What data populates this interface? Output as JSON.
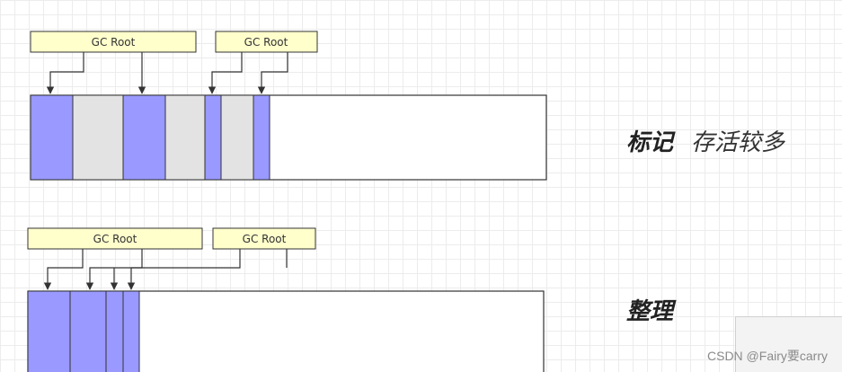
{
  "diagram": {
    "colors": {
      "live": "#9999ff",
      "garbage": "#e3e3e3",
      "free": "#ffffff",
      "root_fill": "#ffffcc",
      "line": "#333333"
    },
    "mark_phase": {
      "roots": [
        "GC Root",
        "GC Root"
      ],
      "title": "标记",
      "subtitle": "存活较多"
    },
    "compact_phase": {
      "roots": [
        "GC Root",
        "GC Root"
      ],
      "title": "整理"
    }
  },
  "watermark": "CSDN @Fairy要carry"
}
